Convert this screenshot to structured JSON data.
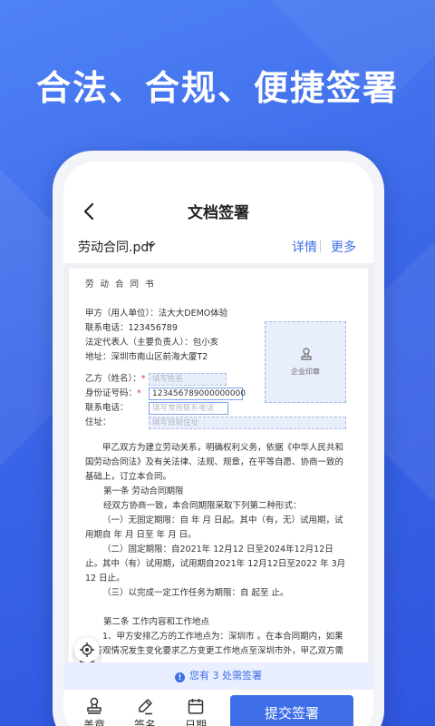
{
  "headline": "合法、合规、便捷签署",
  "nav": {
    "title": "文档签署"
  },
  "file": {
    "name": "劳动合同.pdf",
    "detail_link": "详情",
    "more_link": "更多"
  },
  "document": {
    "title": "劳 动 合 同 书",
    "party_a": [
      "甲方（用人单位）：法大大DEMO体验",
      "联系电话：123456789",
      "法定代表人（主要负责人）：包小亥",
      "地址：深圳市南山区前海大厦T2"
    ],
    "seal_label": "企业印章",
    "party_b": {
      "name_label": "乙方（姓名）：",
      "name_placeholder": "填写姓名",
      "id_label": "身份证号码：",
      "id_value": "123456789000000000",
      "phone_label": "联系电话：",
      "phone_placeholder": "填写常用联系电话",
      "address_label": "住址：",
      "address_placeholder": "填写目前住址"
    },
    "intro": "甲乙双方为建立劳动关系，明确权利义务，依据《中华人民共和国劳动合同法》及有关法律、法规、规章，在平等自愿、协商一致的基础上，订立本合同。",
    "section1_title": "第一条  劳动合同期限",
    "section1_lead": "经双方协商一致，本合同期限采取下列第二种形式：",
    "clause1": "（一）无固定期限：自      年      月      日起。其中（有，无）试用期，试用期自      年      月      日至      年      月      日。",
    "clause2": "（二）固定期限：自2021年 12月12 日至2024年12月12日止。其中（有）试用期，试用期自2021年 12月12日至2022 年 3月12 日止。",
    "clause3": "（三）以完成一定工作任务为期限：自      起至      止。",
    "section2_title": "第二条  工作内容和工作地点",
    "section2_text": "1、甲方安排乙方的工作地点为：深圳市 。在本合同期内，如果甲答观情况发生变化要求乙方变更工作地点至深圳市外，甲乙双方需"
  },
  "notice": {
    "text": "您有 3 处需签署"
  },
  "toolbar": {
    "seal": "盖章",
    "sign": "签名",
    "date": "日期",
    "submit": "提交签署"
  },
  "colors": {
    "accent": "#3d6ee8",
    "background": "#3a66e8"
  },
  "icons": [
    "back-arrow-icon",
    "chevron-down-icon",
    "stamp-icon",
    "fullscreen-icon",
    "locate-icon",
    "info-icon",
    "pen-icon",
    "calendar-icon"
  ]
}
